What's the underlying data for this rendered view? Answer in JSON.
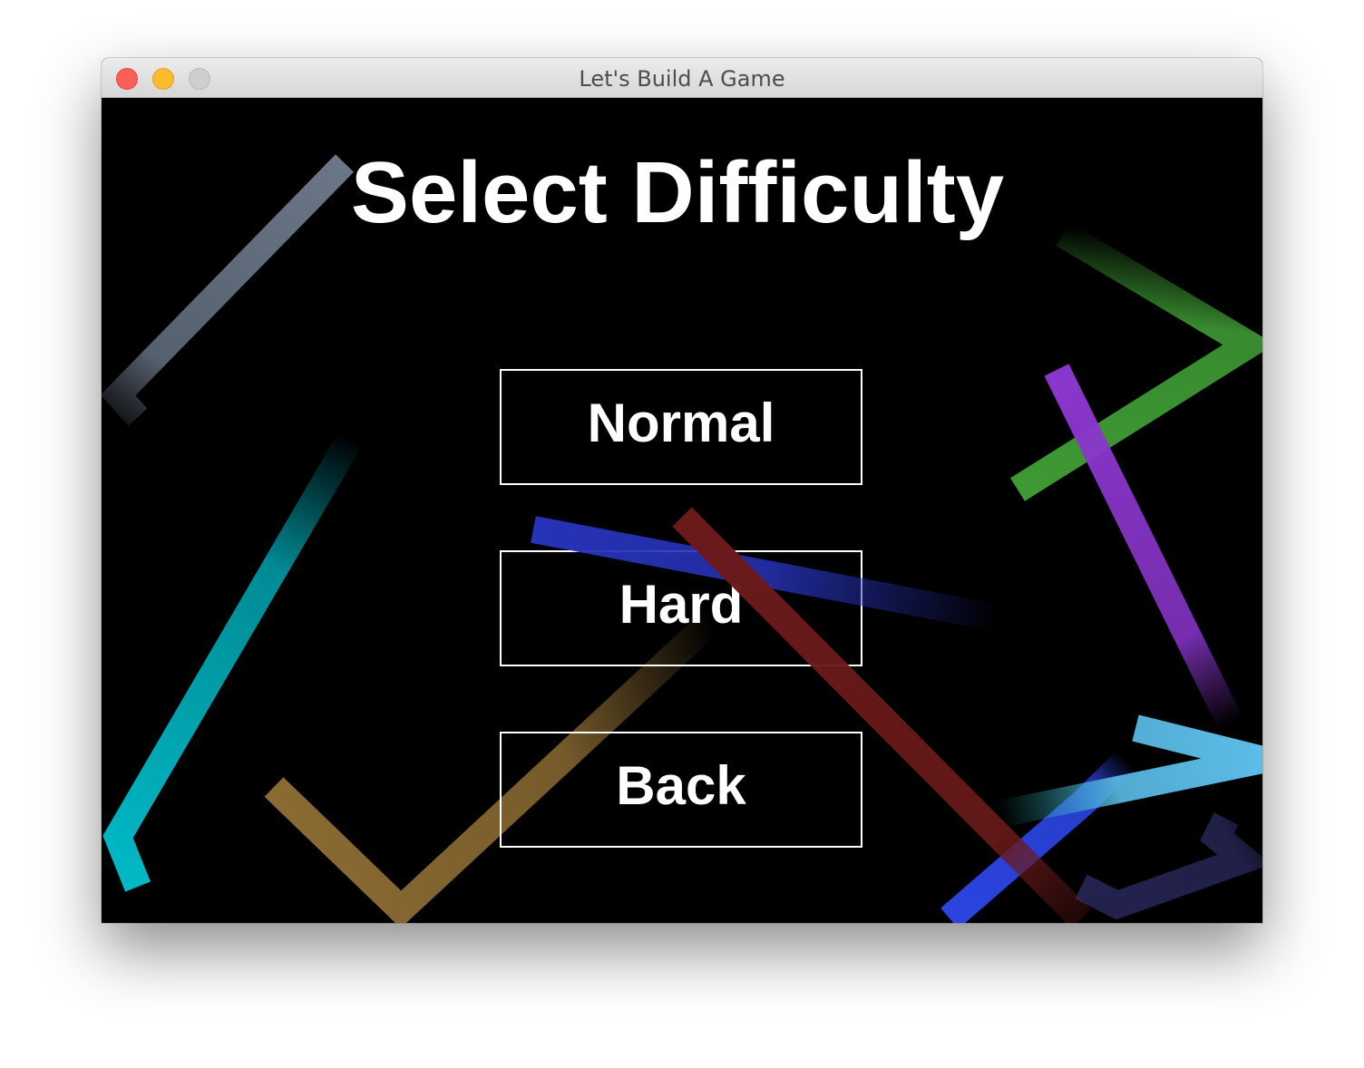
{
  "window": {
    "title": "Let's Build A Game"
  },
  "screen": {
    "heading": "Select Difficulty"
  },
  "menu": {
    "normal_label": "Normal",
    "hard_label": "Hard",
    "back_label": "Back"
  },
  "colors": {
    "background": "#000000",
    "text": "#ffffff",
    "trail_gray": "#6b7789",
    "trail_green": "#3e9a34",
    "trail_purple": "#8a36cc",
    "trail_cyan": "#00b9c6",
    "trail_brown": "#8a6a32",
    "trail_blue": "#2733b8",
    "trail_red": "#6b1a1a",
    "trail_light_blue": "#5bbde8",
    "trail_royal_blue": "#2b44e0",
    "trail_navy": "#23234f"
  }
}
